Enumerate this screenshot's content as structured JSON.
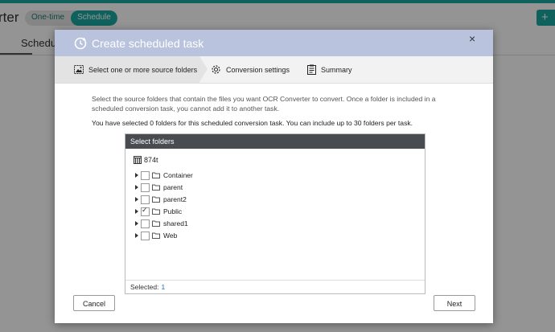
{
  "app": {
    "title": "rter",
    "mode_tabs": [
      "One-time",
      "Schedule"
    ],
    "add_label": "+",
    "page_tab": "Schedul"
  },
  "dialog": {
    "title": "Create scheduled task",
    "close": "×",
    "steps": [
      {
        "label": "Select one or more source folders"
      },
      {
        "label": "Conversion settings"
      },
      {
        "label": "Summary"
      }
    ],
    "description": "Select the source folders that contain the files you want OCR Converter to convert. Once a folder is included in a scheduled conversion task, you cannot add it to another task.",
    "selection_info": "You have selected 0 folders for this scheduled conversion task. You can include up to 30 folders per task.",
    "folder_box": {
      "header": "Select folders",
      "root": "874t",
      "folders": [
        {
          "name": "Container",
          "checked": false
        },
        {
          "name": "parent",
          "checked": false
        },
        {
          "name": "parent2",
          "checked": false
        },
        {
          "name": "Public",
          "checked": true
        },
        {
          "name": "shared1",
          "checked": false
        },
        {
          "name": "Web",
          "checked": false
        }
      ],
      "selected_label": "Selected:",
      "selected_count": "1"
    },
    "cancel_label": "Cancel",
    "next_label": "Next"
  }
}
